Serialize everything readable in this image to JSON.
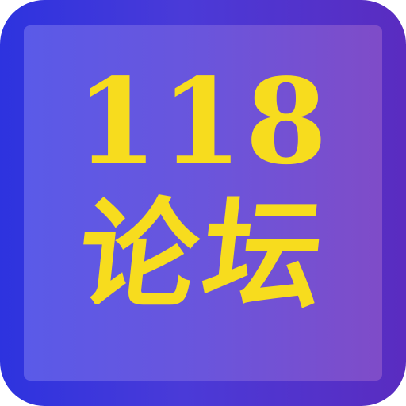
{
  "logo": {
    "number": "118",
    "name": "论坛"
  },
  "colors": {
    "outer_left": "#2d33df",
    "outer_right": "#5a2cc0",
    "inner_left": "#5a5ae8",
    "inner_right": "#7f4cc8",
    "text": "#f7dc1e"
  }
}
